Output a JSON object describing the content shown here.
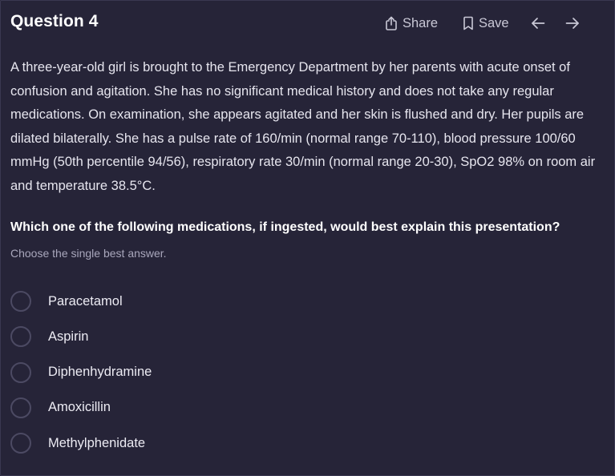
{
  "header": {
    "title": "Question 4",
    "share_label": "Share",
    "save_label": "Save",
    "icons": {
      "share": "share-icon",
      "save": "bookmark-icon",
      "back": "arrow-left-icon",
      "forward": "arrow-right-icon"
    }
  },
  "question": {
    "stem": "A three-year-old girl is brought to the Emergency Department by her parents with acute onset of confusion and agitation. She has no significant medical history and does not take any regular medications. On examination, she appears agitated and her skin is flushed and dry. Her pupils are dilated bilaterally. She has a pulse rate of 160/min (normal range 70-110), blood pressure 100/60 mmHg (50th percentile 94/56), respiratory rate 30/min (normal range 20-30), SpO2 98% on room air and temperature 38.5°C.",
    "prompt": "Which one of the following medications, if ingested, would best explain this presentation?",
    "instruction": "Choose the single best answer."
  },
  "options": [
    {
      "label": "Paracetamol"
    },
    {
      "label": "Aspirin"
    },
    {
      "label": "Diphenhydramine"
    },
    {
      "label": "Amoxicillin"
    },
    {
      "label": "Methylphenidate"
    }
  ],
  "colors": {
    "background": "#262438",
    "text": "#ECEBF3",
    "muted": "#A9A7BC",
    "radio_border": "#4C4A63"
  }
}
